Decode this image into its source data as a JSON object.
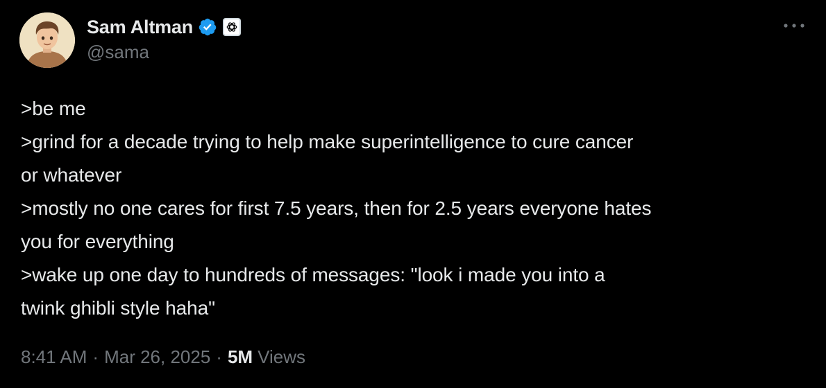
{
  "author": {
    "display_name": "Sam Altman",
    "handle": "@sama",
    "verified_badge_icon": "verified-check-icon",
    "affiliate_badge_icon": "openai-logo-icon",
    "verified_color": "#1d9bf0"
  },
  "more_icon": "more-horizontal-icon",
  "tweet": {
    "lines": [
      ">be me",
      ">grind for a decade trying to help make superintelligence to cure cancer",
      "or whatever",
      ">mostly no one cares for first 7.5 years, then for 2.5 years everyone hates",
      "you for everything",
      ">wake up one day to hundreds of messages: \"look i made you into a",
      "twink ghibli style haha\""
    ]
  },
  "meta": {
    "time": "8:41 AM",
    "separator": "·",
    "date": "Mar 26, 2025",
    "views_count": "5M",
    "views_label": "Views"
  },
  "colors": {
    "background": "#000000",
    "primary_text": "#e7e9ea",
    "secondary_text": "#71767b"
  }
}
